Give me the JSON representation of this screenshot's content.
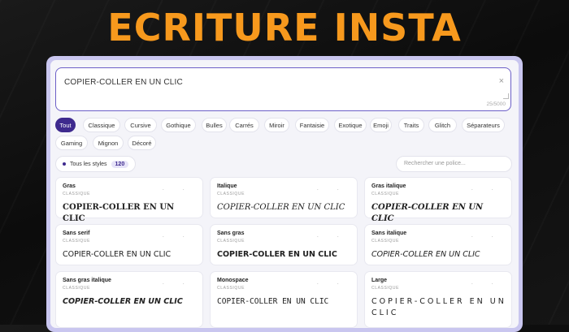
{
  "banner": {
    "title": "ECRITURE INSTA"
  },
  "editor": {
    "value": "COPIER-COLLER EN UN CLIC",
    "clear_glyph": "×",
    "counter": "25/5000"
  },
  "filters": [
    {
      "label": "Tout",
      "active": true
    },
    {
      "label": "Classique"
    },
    {
      "label": "Cursive"
    },
    {
      "label": "Gothique"
    },
    {
      "label": "Bulles"
    },
    {
      "label": "Carrés"
    },
    {
      "label": "Miroir"
    },
    {
      "label": "Fantaisie"
    },
    {
      "label": "Exotique"
    },
    {
      "label": "Emoji"
    },
    {
      "label": "Traits"
    },
    {
      "label": "Glitch"
    },
    {
      "label": "Séparateurs"
    },
    {
      "label": "Gaming"
    },
    {
      "label": "Mignon"
    },
    {
      "label": "Décoré"
    }
  ],
  "styles_toggle": {
    "label": "Tous les styles",
    "count": "120"
  },
  "search": {
    "placeholder": "Rechercher une police..."
  },
  "card_actions": "· ·",
  "cards": [
    {
      "name": "Gras",
      "category": "CLASSIQUE",
      "preview": "COPIER-COLLER EN UN CLIC",
      "style": "p-bold"
    },
    {
      "name": "Italique",
      "category": "CLASSIQUE",
      "preview": "COPIER-COLLER EN UN CLIC",
      "style": "p-italic"
    },
    {
      "name": "Gras italique",
      "category": "CLASSIQUE",
      "preview": "COPIER-COLLER EN UN CLIC",
      "style": "p-bolditalic"
    },
    {
      "name": "Sans serif",
      "category": "CLASSIQUE",
      "preview": "COPIER-COLLER EN UN CLIC",
      "style": "p-sans"
    },
    {
      "name": "Sans gras",
      "category": "CLASSIQUE",
      "preview": "COPIER-COLLER EN UN CLIC",
      "style": "p-sansbold"
    },
    {
      "name": "Sans italique",
      "category": "CLASSIQUE",
      "preview": "COPIER-COLLER EN UN CLIC",
      "style": "p-sansitalic"
    },
    {
      "name": "Sans gras italique",
      "category": "CLASSIQUE",
      "preview": "COPIER-COLLER EN UN CLIC",
      "style": "p-sansbolditalic"
    },
    {
      "name": "Monospace",
      "category": "CLASSIQUE",
      "preview": "COPIER-COLLER EN UN CLIC",
      "style": "p-mono"
    },
    {
      "name": "Large",
      "category": "CLASSIQUE",
      "preview": "COPIER-COLLER EN UN CLIC",
      "style": "p-large"
    }
  ],
  "colors": {
    "accent": "#3e2a8e",
    "banner": "#f7991d",
    "frame": "#c9c6ef"
  }
}
